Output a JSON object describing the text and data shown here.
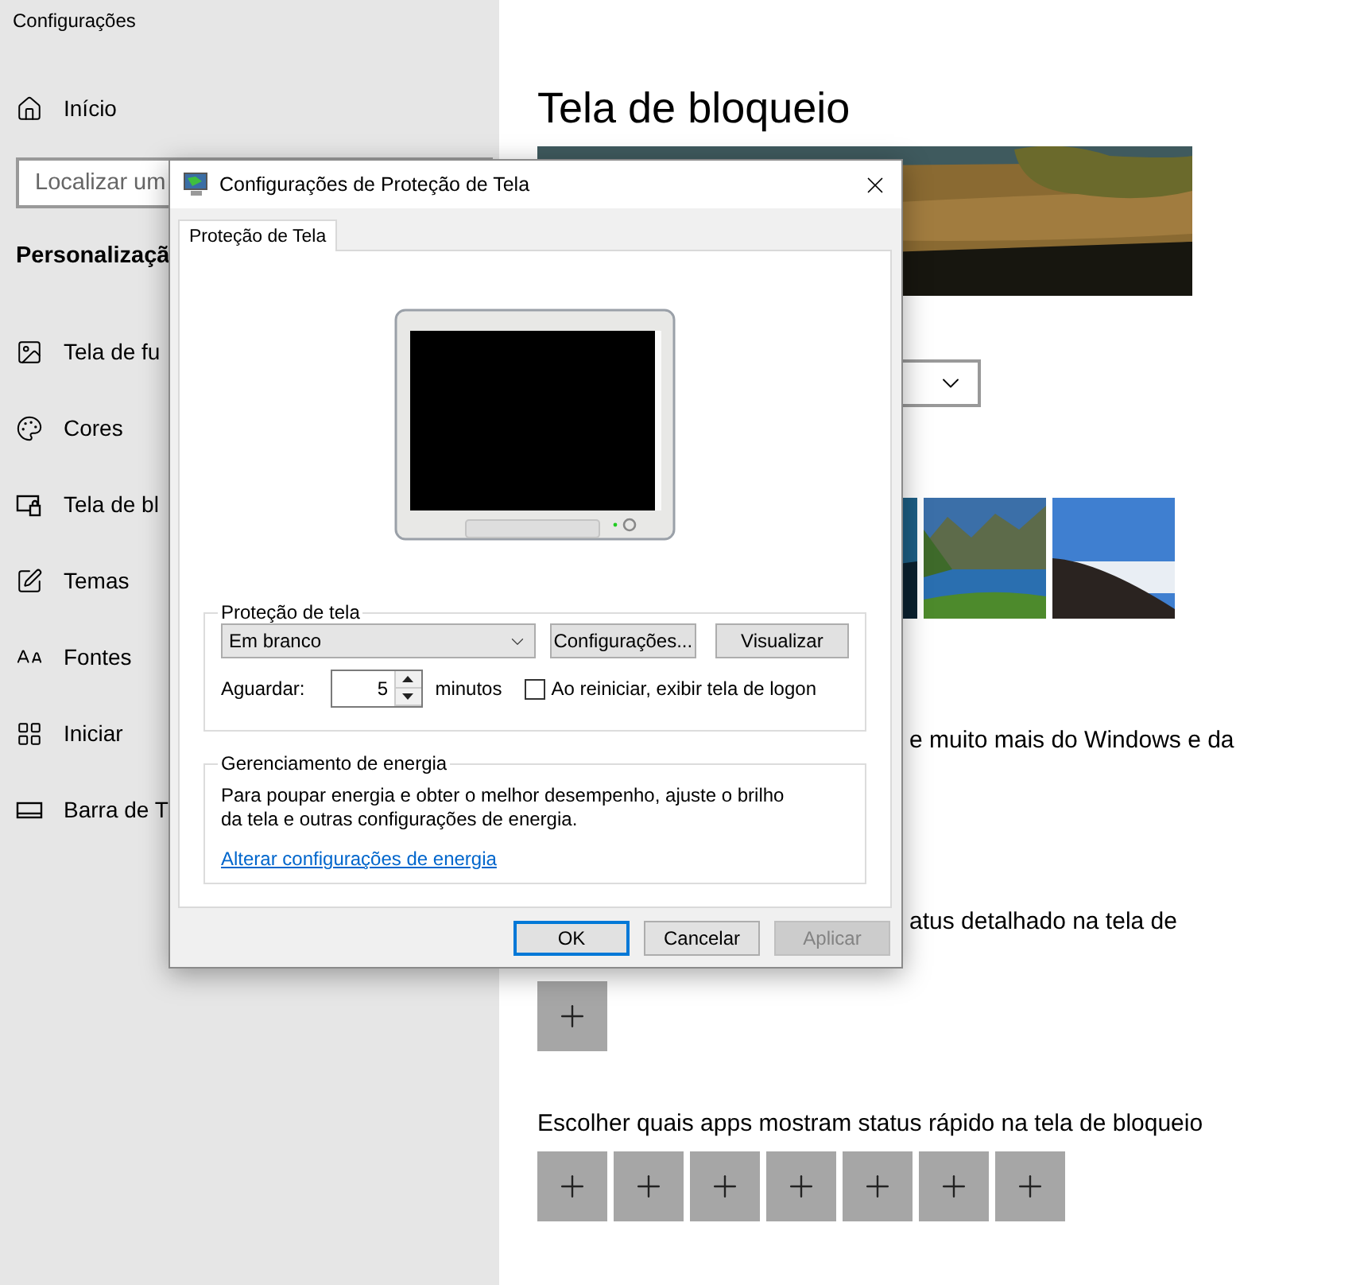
{
  "settings": {
    "app_title": "Configurações",
    "home": "Início",
    "search": {
      "placeholder": "Localizar um"
    },
    "section": "Personalizaçã",
    "nav_items": [
      {
        "label": "Tela de fu"
      },
      {
        "label": "Cores"
      },
      {
        "label": "Tela de bl"
      },
      {
        "label": "Temas"
      },
      {
        "label": "Fontes"
      },
      {
        "label": "Iniciar"
      },
      {
        "label": "Barra de T"
      }
    ]
  },
  "page": {
    "title": "Tela de bloqueio",
    "description_fragment": "e muito mais do Windows e da",
    "detailed_status_fragment": "atus detalhado na tela de",
    "detailed_slots": [
      {
        "kind": "add"
      }
    ],
    "quick_status_label": "Escolher quais apps mostram status rápido na tela de bloqueio",
    "quick_slots": [
      {
        "kind": "add"
      },
      {
        "kind": "add"
      },
      {
        "kind": "add"
      },
      {
        "kind": "add"
      },
      {
        "kind": "add"
      },
      {
        "kind": "add"
      },
      {
        "kind": "add"
      }
    ]
  },
  "dialog": {
    "title": "Configurações de Proteção de Tela",
    "tabs": [
      {
        "label": "Proteção de Tela",
        "selected": true
      }
    ],
    "screensaver": {
      "legend": "Proteção de tela",
      "value": "Em branco",
      "buttons": [
        "Configurações...",
        "Visualizar"
      ],
      "wait_label": "Aguardar:",
      "wait_value": "5",
      "wait_unit": "minutos",
      "logon_checkbox": {
        "label": "Ao reiniciar, exibir tela de logon",
        "checked": false
      }
    },
    "power": {
      "legend": "Gerenciamento de energia",
      "text": "Para poupar energia e obter o melhor desempenho, ajuste o brilho da tela e outras configurações de energia.",
      "link": "Alterar configurações de energia"
    },
    "footer_buttons": [
      {
        "label": "OK",
        "default": true,
        "disabled": false
      },
      {
        "label": "Cancelar",
        "default": false,
        "disabled": false
      },
      {
        "label": "Aplicar",
        "default": false,
        "disabled": true
      }
    ]
  }
}
